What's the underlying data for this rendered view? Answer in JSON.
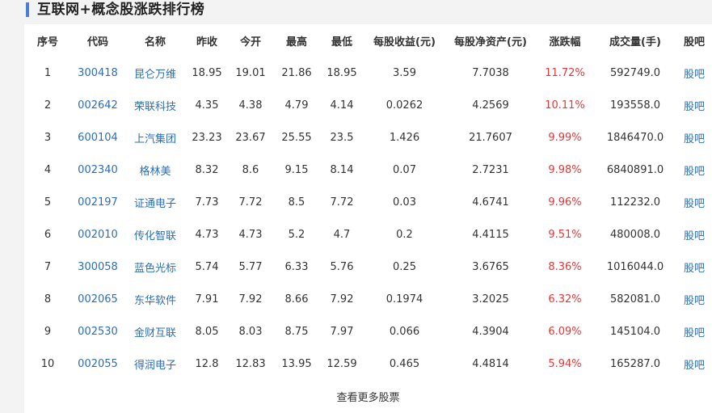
{
  "title": "互联网+概念股涨跌排行榜",
  "columns": [
    "序号",
    "代码",
    "名称",
    "昨收",
    "今开",
    "最高",
    "最低",
    "每股收益(元)",
    "每股净资产(元)",
    "涨跌幅",
    "成交量(手)",
    "股吧"
  ],
  "rows": [
    {
      "rank": "1",
      "code": "300418",
      "name": "昆仑万维",
      "prev_close": "18.95",
      "open": "19.01",
      "high": "21.86",
      "low": "18.95",
      "eps": "3.59",
      "bvps": "7.7038",
      "change": "11.72%",
      "volume": "592749.0",
      "forum": "股吧"
    },
    {
      "rank": "2",
      "code": "002642",
      "name": "荣联科技",
      "prev_close": "4.35",
      "open": "4.38",
      "high": "4.79",
      "low": "4.14",
      "eps": "0.0262",
      "bvps": "4.2569",
      "change": "10.11%",
      "volume": "193558.0",
      "forum": "股吧"
    },
    {
      "rank": "3",
      "code": "600104",
      "name": "上汽集团",
      "prev_close": "23.23",
      "open": "23.67",
      "high": "25.55",
      "low": "23.5",
      "eps": "1.426",
      "bvps": "21.7607",
      "change": "9.99%",
      "volume": "1846470.0",
      "forum": "股吧"
    },
    {
      "rank": "4",
      "code": "002340",
      "name": "格林美",
      "prev_close": "8.32",
      "open": "8.6",
      "high": "9.15",
      "low": "8.14",
      "eps": "0.07",
      "bvps": "2.7231",
      "change": "9.98%",
      "volume": "6840891.0",
      "forum": "股吧"
    },
    {
      "rank": "5",
      "code": "002197",
      "name": "证通电子",
      "prev_close": "7.73",
      "open": "7.72",
      "high": "8.5",
      "low": "7.72",
      "eps": "0.03",
      "bvps": "4.6741",
      "change": "9.96%",
      "volume": "112232.0",
      "forum": "股吧"
    },
    {
      "rank": "6",
      "code": "002010",
      "name": "传化智联",
      "prev_close": "4.73",
      "open": "4.73",
      "high": "5.2",
      "low": "4.7",
      "eps": "0.2",
      "bvps": "4.4115",
      "change": "9.51%",
      "volume": "480008.0",
      "forum": "股吧"
    },
    {
      "rank": "7",
      "code": "300058",
      "name": "蓝色光标",
      "prev_close": "5.74",
      "open": "5.77",
      "high": "6.33",
      "low": "5.76",
      "eps": "0.25",
      "bvps": "3.6765",
      "change": "8.36%",
      "volume": "1016044.0",
      "forum": "股吧"
    },
    {
      "rank": "8",
      "code": "002065",
      "name": "东华软件",
      "prev_close": "7.91",
      "open": "7.92",
      "high": "8.66",
      "low": "7.92",
      "eps": "0.1974",
      "bvps": "3.2025",
      "change": "6.32%",
      "volume": "582081.0",
      "forum": "股吧"
    },
    {
      "rank": "9",
      "code": "002530",
      "name": "金财互联",
      "prev_close": "8.05",
      "open": "8.03",
      "high": "8.75",
      "low": "7.97",
      "eps": "0.066",
      "bvps": "4.3904",
      "change": "6.09%",
      "volume": "145104.0",
      "forum": "股吧"
    },
    {
      "rank": "10",
      "code": "002055",
      "name": "得润电子",
      "prev_close": "12.8",
      "open": "12.83",
      "high": "13.95",
      "low": "12.59",
      "eps": "0.465",
      "bvps": "4.4814",
      "change": "5.94%",
      "volume": "165287.0",
      "forum": "股吧"
    }
  ],
  "more_link": "查看更多股票",
  "colors": {
    "accent_bar": "#4b7fd6",
    "link": "#2d6eb5",
    "change_up": "#e03a3a"
  }
}
